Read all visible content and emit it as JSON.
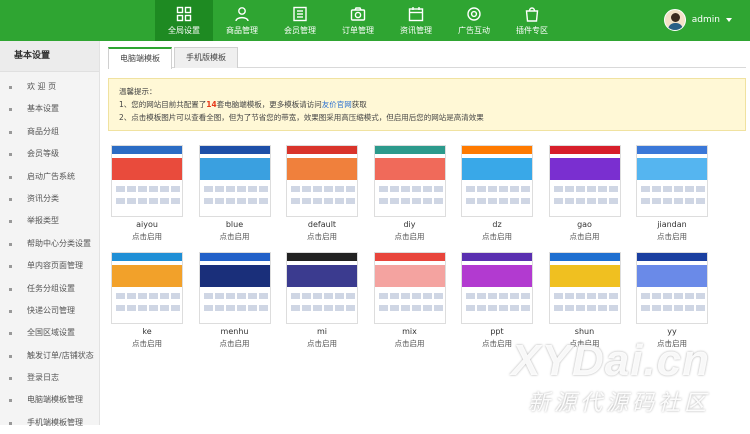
{
  "header": {
    "nav": [
      {
        "label": "全局设置",
        "icon": "grid-icon",
        "active": true
      },
      {
        "label": "商品管理",
        "icon": "user-icon",
        "active": false
      },
      {
        "label": "会员管理",
        "icon": "list-icon",
        "active": false
      },
      {
        "label": "订单管理",
        "icon": "camera-icon",
        "active": false
      },
      {
        "label": "资讯管理",
        "icon": "calendar-icon",
        "active": false
      },
      {
        "label": "广告互动",
        "icon": "gear-icon",
        "active": false
      },
      {
        "label": "插件专区",
        "icon": "bag-icon",
        "active": false
      }
    ],
    "username": "admin"
  },
  "sidebar": {
    "title": "基本设置",
    "items": [
      {
        "label": "欢 迎 页"
      },
      {
        "label": "基本设置"
      },
      {
        "label": "商品分组"
      },
      {
        "label": "会员等级"
      },
      {
        "label": "启动广告系统"
      },
      {
        "label": "资讯分类"
      },
      {
        "label": "举报类型"
      },
      {
        "label": "帮助中心分类设置"
      },
      {
        "label": "单内容页面管理"
      },
      {
        "label": "任务分组设置"
      },
      {
        "label": "快递公司管理"
      },
      {
        "label": "全国区域设置"
      },
      {
        "label": "触发订单/店铺状态"
      },
      {
        "label": "登录日志"
      },
      {
        "label": "电脑端模板管理"
      },
      {
        "label": "手机端模板管理"
      }
    ]
  },
  "tabs": [
    {
      "label": "电脑端模板",
      "active": true
    },
    {
      "label": "手机版模板",
      "active": false
    }
  ],
  "notice": {
    "title": "温馨提示：",
    "line1_a": "1、您的网站目前共配置了",
    "line1_count": "14",
    "line1_b": "套电脑端模板，更多模板请访问",
    "line1_link": "友价官网",
    "line1_c": "获取",
    "line2": "2、点击模板图片可以查看全图，但为了节省您的带宽，效果图采用高压缩模式，但启用后您的网站是高清效果"
  },
  "templates": [
    {
      "name": "aiyou",
      "action": "点击启用",
      "hdr": "#2b6cc4",
      "banner": "#e94b3c"
    },
    {
      "name": "blue",
      "action": "点击启用",
      "hdr": "#1d4fa8",
      "banner": "#3aa0e0"
    },
    {
      "name": "default",
      "action": "点击启用",
      "hdr": "#d9342b",
      "banner": "#f0803c"
    },
    {
      "name": "diy",
      "action": "点击启用",
      "hdr": "#2c9a8c",
      "banner": "#f06a5a"
    },
    {
      "name": "dz",
      "action": "点击启用",
      "hdr": "#ff7a00",
      "banner": "#39a8e8"
    },
    {
      "name": "gao",
      "action": "点击启用",
      "hdr": "#d71f2b",
      "banner": "#7a2fd0"
    },
    {
      "name": "jiandan",
      "action": "点击启用",
      "hdr": "#3b78d8",
      "banner": "#55b5f0"
    },
    {
      "name": "ke",
      "action": "点击启用",
      "hdr": "#1f8fd6",
      "banner": "#f2a12a"
    },
    {
      "name": "menhu",
      "action": "点击启用",
      "hdr": "#2260c8",
      "banner": "#1a2f7a"
    },
    {
      "name": "mi",
      "action": "点击启用",
      "hdr": "#222222",
      "banner": "#3b3b8f"
    },
    {
      "name": "mix",
      "action": "点击启用",
      "hdr": "#e8453c",
      "banner": "#f4a3a0"
    },
    {
      "name": "ppt",
      "action": "点击启用",
      "hdr": "#5a2fb0",
      "banner": "#b23ad0"
    },
    {
      "name": "shun",
      "action": "点击启用",
      "hdr": "#1e6fd0",
      "banner": "#f0c020"
    },
    {
      "name": "yy",
      "action": "点击启用",
      "hdr": "#1a3fa0",
      "banner": "#6a8ae8"
    }
  ],
  "watermark": {
    "line1": "XYDai.cn",
    "line2": "新源代源码社区"
  },
  "colors": {
    "brand": "#2fa532",
    "brand_dark": "#1e8a22",
    "notice_bg": "#fff8d6",
    "highlight": "#e63a1a"
  }
}
